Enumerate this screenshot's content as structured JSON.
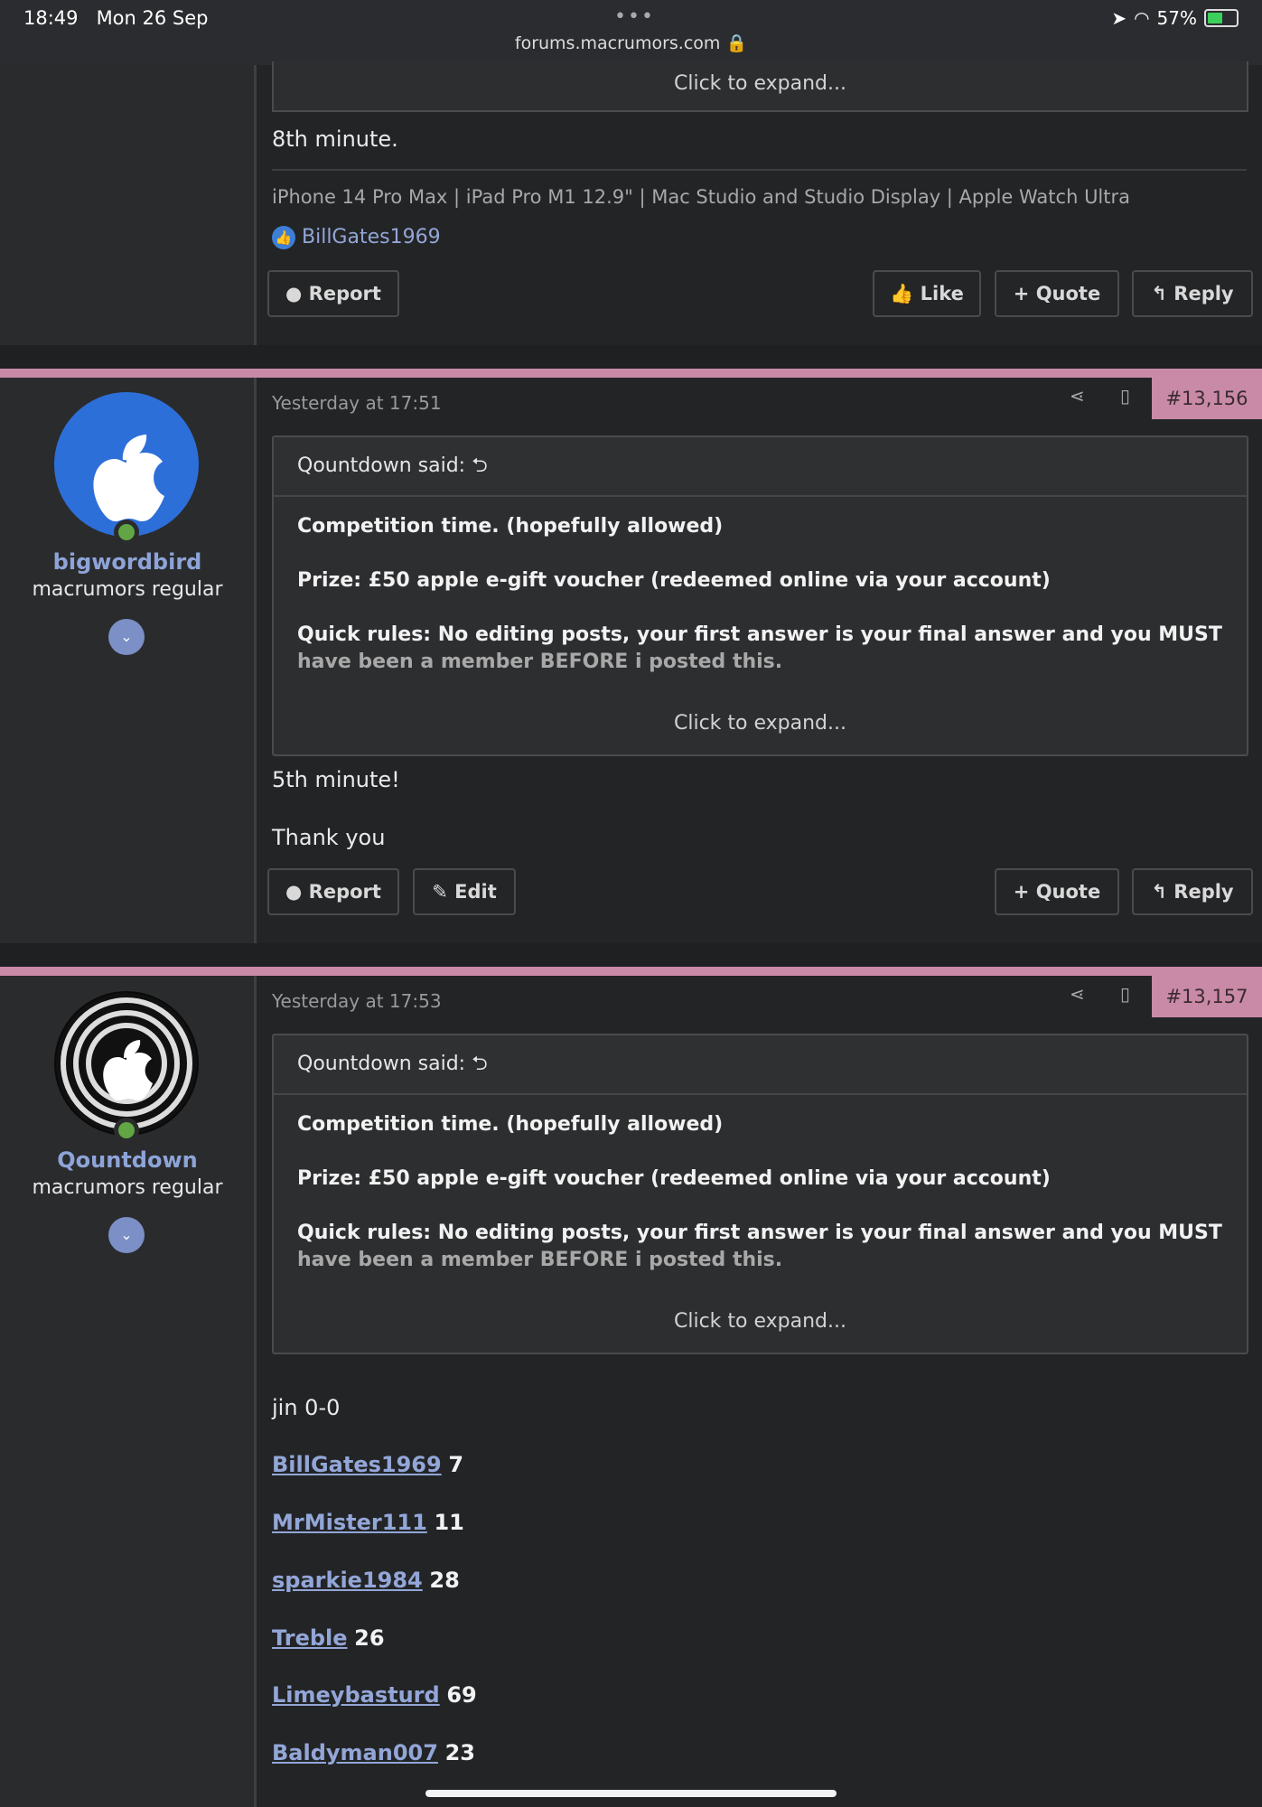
{
  "status_bar": {
    "time": "18:49",
    "date": "Mon 26 Sep",
    "dots": "•••",
    "url": "forums.macrumors.com",
    "battery": "57%"
  },
  "prev_post": {
    "expand": "Click to expand...",
    "body": "8th minute.",
    "signature": "iPhone 14 Pro Max | iPad Pro M1 12.9\" | Mac Studio and Studio Display | Apple Watch Ultra",
    "liked_by": "BillGates1969",
    "buttons": {
      "report": "Report",
      "like": "Like",
      "quote": "Quote",
      "reply": "Reply"
    }
  },
  "post1": {
    "username": "bigwordbird",
    "usertitle": "macrumors regular",
    "date": "Yesterday at 17:51",
    "number": "#13,156",
    "quote_author": "Qountdown said:",
    "quote_lines": {
      "l1": "Competition time. (hopefully allowed)",
      "l2": "Prize: £50 apple e-gift voucher (redeemed online via your account)",
      "l3a": "Quick rules: No editing posts, your first answer is your final answer and you MUST",
      "l3b": "have been a member BEFORE i posted this."
    },
    "expand": "Click to expand...",
    "body1": "5th minute!",
    "body2": "Thank you",
    "buttons": {
      "report": "Report",
      "edit": "Edit",
      "quote": "Quote",
      "reply": "Reply"
    }
  },
  "post2": {
    "username": "Qountdown",
    "usertitle": "macrumors regular",
    "date": "Yesterday at 17:53",
    "number": "#13,157",
    "quote_author": "Qountdown said:",
    "quote_lines": {
      "l1": "Competition time. (hopefully allowed)",
      "l2": "Prize: £50 apple e-gift voucher (redeemed online via your account)",
      "l3a": "Quick rules: No editing posts, your first answer is your final answer and you MUST",
      "l3b": "have been a member BEFORE i posted this."
    },
    "expand": "Click to expand...",
    "body_first": "jin 0-0",
    "entries": [
      {
        "name": "BillGates1969",
        "score": "7"
      },
      {
        "name": "MrMister111",
        "score": "11"
      },
      {
        "name": "sparkie1984",
        "score": "28"
      },
      {
        "name": "Treble",
        "score": "26"
      },
      {
        "name": "Limeybasturd",
        "score": "69"
      },
      {
        "name": "Baldyman007",
        "score": "23"
      }
    ]
  },
  "colors": {
    "accent_pink": "#c98aa7",
    "link_blue": "#93a6d8",
    "avatar_blue": "#2d6fd9"
  }
}
